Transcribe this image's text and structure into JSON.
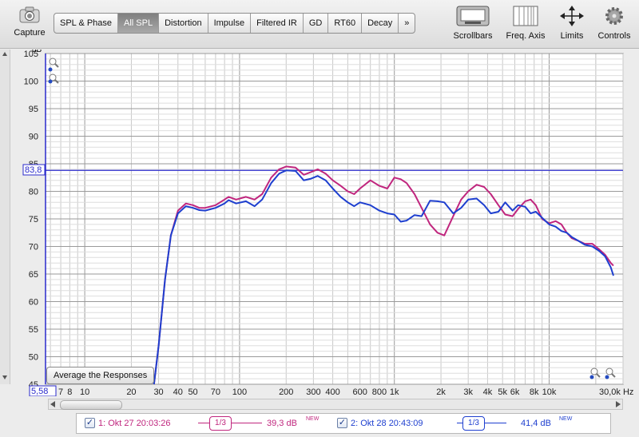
{
  "toolbar": {
    "capture_label": "Capture",
    "tabs": [
      "SPL & Phase",
      "All SPL",
      "Distortion",
      "Impulse",
      "Filtered IR",
      "GD",
      "RT60",
      "Decay",
      "»"
    ],
    "selected_tab": "All SPL",
    "right_tools": [
      "Scrollbars",
      "Freq. Axis",
      "Limits",
      "Controls"
    ]
  },
  "plot": {
    "average_button": "Average the Responses",
    "cursor_level": "83,8",
    "cursor_freq": "5,58",
    "colors": {
      "series1": "#c0267e",
      "series2": "#1e3fcf",
      "cursor": "#2a2acb"
    }
  },
  "chart_data": {
    "type": "line",
    "ylabel": "dB",
    "ylim": [
      45,
      105
    ],
    "yticks": [
      "105",
      "100",
      "95",
      "90",
      "85",
      "80",
      "75",
      "70",
      "65",
      "60",
      "55",
      "50",
      "45"
    ],
    "xscale": "log",
    "xlim": [
      5.58,
      30000
    ],
    "xticks": [
      {
        "v": 7,
        "t": "7"
      },
      {
        "v": 8,
        "t": "8"
      },
      {
        "v": 10,
        "t": "10"
      },
      {
        "v": 20,
        "t": "20"
      },
      {
        "v": 30,
        "t": "30"
      },
      {
        "v": 40,
        "t": "40"
      },
      {
        "v": 50,
        "t": "50"
      },
      {
        "v": 70,
        "t": "70"
      },
      {
        "v": 100,
        "t": "100"
      },
      {
        "v": 200,
        "t": "200"
      },
      {
        "v": 300,
        "t": "300"
      },
      {
        "v": 400,
        "t": "400"
      },
      {
        "v": 600,
        "t": "600"
      },
      {
        "v": 800,
        "t": "800"
      },
      {
        "v": 1000,
        "t": "1k"
      },
      {
        "v": 2000,
        "t": "2k"
      },
      {
        "v": 3000,
        "t": "3k"
      },
      {
        "v": 4000,
        "t": "4k"
      },
      {
        "v": 5000,
        "t": "5k"
      },
      {
        "v": 6000,
        "t": "6k"
      },
      {
        "v": 8000,
        "t": "8k"
      },
      {
        "v": 10000,
        "t": "10k"
      },
      {
        "v": 30000,
        "t": "30,0k Hz"
      }
    ],
    "grid": true,
    "series": [
      {
        "points": [
          [
            28,
            44
          ],
          [
            30,
            52
          ],
          [
            33,
            64
          ],
          [
            36,
            72
          ],
          [
            40,
            76.5
          ],
          [
            45,
            77.8
          ],
          [
            50,
            77.5
          ],
          [
            55,
            77
          ],
          [
            60,
            77
          ],
          [
            70,
            77.5
          ],
          [
            80,
            78.5
          ],
          [
            85,
            79
          ],
          [
            95,
            78.5
          ],
          [
            110,
            79
          ],
          [
            125,
            78.5
          ],
          [
            140,
            79.5
          ],
          [
            160,
            82.5
          ],
          [
            180,
            84
          ],
          [
            200,
            84.5
          ],
          [
            230,
            84.3
          ],
          [
            260,
            83
          ],
          [
            290,
            83.5
          ],
          [
            320,
            84
          ],
          [
            360,
            83.2
          ],
          [
            400,
            82
          ],
          [
            450,
            81
          ],
          [
            500,
            80
          ],
          [
            550,
            79.5
          ],
          [
            600,
            80.5
          ],
          [
            700,
            82
          ],
          [
            800,
            81
          ],
          [
            900,
            80.5
          ],
          [
            1000,
            82.5
          ],
          [
            1100,
            82.2
          ],
          [
            1200,
            81.5
          ],
          [
            1350,
            79.5
          ],
          [
            1500,
            77
          ],
          [
            1700,
            74
          ],
          [
            1900,
            72.5
          ],
          [
            2100,
            72
          ],
          [
            2400,
            75.5
          ],
          [
            2700,
            78.5
          ],
          [
            3000,
            80
          ],
          [
            3400,
            81.2
          ],
          [
            3800,
            80.8
          ],
          [
            4200,
            79.5
          ],
          [
            4700,
            77.5
          ],
          [
            5200,
            75.8
          ],
          [
            5800,
            75.5
          ],
          [
            6300,
            76.8
          ],
          [
            7000,
            78.2
          ],
          [
            7600,
            78.5
          ],
          [
            8200,
            77.5
          ],
          [
            9000,
            75
          ],
          [
            10000,
            74.2
          ],
          [
            11000,
            74.6
          ],
          [
            12000,
            74
          ],
          [
            13000,
            72.5
          ],
          [
            14000,
            71.5
          ],
          [
            15500,
            71
          ],
          [
            17000,
            70.5
          ],
          [
            19000,
            70.5
          ],
          [
            21000,
            69.5
          ],
          [
            23000,
            68.5
          ],
          [
            25000,
            67
          ],
          [
            26000,
            66.5
          ]
        ]
      },
      {
        "points": [
          [
            28,
            44
          ],
          [
            30,
            52
          ],
          [
            33,
            64
          ],
          [
            36,
            72
          ],
          [
            40,
            76
          ],
          [
            45,
            77.3
          ],
          [
            50,
            77
          ],
          [
            55,
            76.6
          ],
          [
            60,
            76.5
          ],
          [
            70,
            77
          ],
          [
            80,
            77.8
          ],
          [
            85,
            78.4
          ],
          [
            95,
            77.8
          ],
          [
            110,
            78.2
          ],
          [
            125,
            77.3
          ],
          [
            140,
            78.5
          ],
          [
            160,
            81.5
          ],
          [
            180,
            83.2
          ],
          [
            200,
            83.8
          ],
          [
            230,
            83.7
          ],
          [
            260,
            82
          ],
          [
            290,
            82.3
          ],
          [
            320,
            82.8
          ],
          [
            360,
            82
          ],
          [
            400,
            80.5
          ],
          [
            450,
            79
          ],
          [
            500,
            78
          ],
          [
            550,
            77.3
          ],
          [
            600,
            78
          ],
          [
            700,
            77.5
          ],
          [
            800,
            76.5
          ],
          [
            900,
            76
          ],
          [
            1000,
            75.8
          ],
          [
            1100,
            74.5
          ],
          [
            1200,
            74.7
          ],
          [
            1350,
            75.7
          ],
          [
            1500,
            75.5
          ],
          [
            1700,
            78.3
          ],
          [
            1900,
            78.2
          ],
          [
            2100,
            78
          ],
          [
            2400,
            76
          ],
          [
            2700,
            77
          ],
          [
            3000,
            78.5
          ],
          [
            3400,
            78.7
          ],
          [
            3800,
            77.5
          ],
          [
            4200,
            76
          ],
          [
            4700,
            76.3
          ],
          [
            5200,
            78
          ],
          [
            5800,
            76.5
          ],
          [
            6300,
            77.5
          ],
          [
            7000,
            77.2
          ],
          [
            7600,
            76
          ],
          [
            8200,
            76.3
          ],
          [
            9000,
            75.2
          ],
          [
            10000,
            74
          ],
          [
            11000,
            73.6
          ],
          [
            12000,
            72.8
          ],
          [
            13000,
            72.5
          ],
          [
            14000,
            71.7
          ],
          [
            15500,
            71
          ],
          [
            17000,
            70.3
          ],
          [
            19000,
            70
          ],
          [
            21000,
            69.2
          ],
          [
            23000,
            68.2
          ],
          [
            25000,
            66.2
          ],
          [
            26000,
            64.7
          ]
        ]
      }
    ]
  },
  "legend": {
    "m1_label": "1: Okt 27 20:03:26",
    "m1_smoothing": "1/3",
    "m1_level": "39,3 dB",
    "m1_badge": "NEW",
    "m2_label": "2: Okt 28 20:43:09",
    "m2_smoothing": "1/3",
    "m2_level": "41,4 dB",
    "m2_badge": "NEW"
  }
}
